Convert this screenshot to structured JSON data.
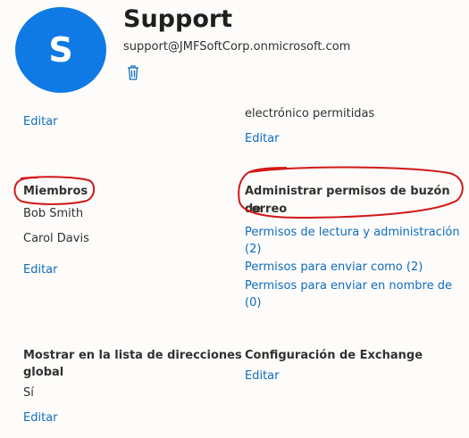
{
  "group": {
    "avatar_initial": "S",
    "name": "Support",
    "email": "support@JMFSoftCorp.onmicrosoft.com"
  },
  "top": {
    "left_edit": "Editar",
    "right_partial_line": "electrónico permitidas",
    "right_edit": "Editar"
  },
  "members": {
    "title": "Miembros",
    "items": [
      "Bob Smith",
      "Carol Davis"
    ],
    "edit": "Editar"
  },
  "mailbox_permissions": {
    "title_line1": "Administrar permisos de buzón de",
    "title_line2": "correo",
    "read_admin_line1": "Permisos de lectura y administración",
    "read_admin_line2": "(2)",
    "send_as": "Permisos para enviar como (2)",
    "send_on_behalf_line1": "Permisos para enviar en nombre de",
    "send_on_behalf_line2": "(0)"
  },
  "gal": {
    "title_line1": "Mostrar en la lista de direcciones",
    "title_line2": "global",
    "value": "Sí",
    "edit": "Editar"
  },
  "exchange": {
    "title": "Configuración de Exchange",
    "edit": "Editar"
  },
  "colors": {
    "accent": "#0f7ae5",
    "link": "#0f6cbd",
    "annotation": "#d01818"
  }
}
